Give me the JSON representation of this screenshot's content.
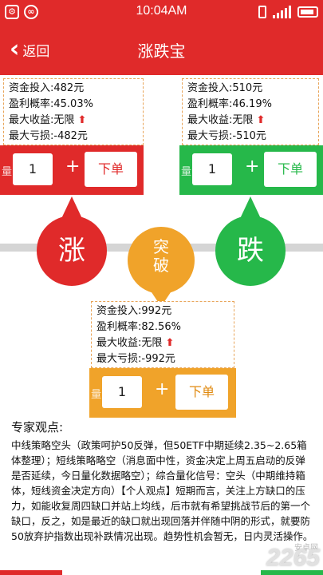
{
  "status_bar": {
    "time": "10:04AM",
    "left_icons": [
      "android-icon",
      "link-icon"
    ],
    "right_icons": [
      "vibrate-icon",
      "signal-icon",
      "battery-icon"
    ]
  },
  "nav": {
    "back_label": "返回",
    "title": "涨跌宝"
  },
  "colors": {
    "red": "#e02a2a",
    "green": "#26b84a",
    "orange": "#f0a32a"
  },
  "rise": {
    "invest": "资金投入:482元",
    "profit_rate": "盈利概率:45.03%",
    "max_gain": "最大收益:无限",
    "max_loss": "最大亏损:-482元",
    "qty_label": "量",
    "qty_value": "1",
    "plus": "+",
    "order_label": "下单",
    "circle_label": "涨"
  },
  "fall": {
    "invest": "资金投入:510元",
    "profit_rate": "盈利概率:46.19%",
    "max_gain": "最大收益:无限",
    "max_loss": "最大亏损:-510元",
    "qty_label": "量",
    "qty_value": "1",
    "plus": "+",
    "order_label": "下单",
    "circle_label": "跌"
  },
  "breakout": {
    "invest": "资金投入:992元",
    "profit_rate": "盈利概率:82.56%",
    "max_gain": "最大收益:无限",
    "max_loss": "最大亏损:-992元",
    "qty_label": "量",
    "qty_value": "1",
    "plus": "+",
    "order_label": "下单",
    "circle_line1": "突",
    "circle_line2": "破"
  },
  "expert": {
    "title": "专家观点:",
    "text": "中线策略空头（政策呵护50反弹，但50ETF中期延续2.35~2.65箱体整理）；短线策略略空（消息面中性，资金决定上周五启动的反弹是否延续，今日量化数据略空）；综合量化信号：空头（中期维持箱体，短线资金决定方向）【个人观点】短期而言，关注上方缺口的压力，如能收复周四缺口并站上均线，后市就有希望挑战节后的第一个缺口，反之，如是最近的缺口就出现回落并伴随中阴的形式，就要防50放弃护指数出现补跌情况出现。趋势性机会暂无，日内灵活操作。"
  },
  "watermark": {
    "main": "2265",
    "sub": "安卓网"
  }
}
